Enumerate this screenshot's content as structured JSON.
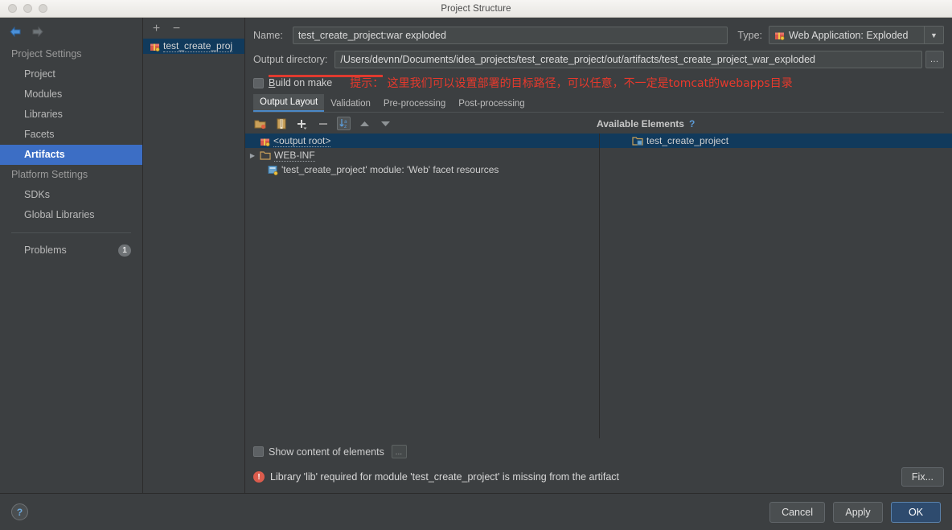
{
  "window": {
    "title": "Project Structure"
  },
  "sidebar": {
    "back_icon": "arrow-left-icon",
    "forward_icon": "arrow-right-icon",
    "groups": [
      {
        "label": "Project Settings",
        "items": [
          {
            "label": "Project",
            "selected": false
          },
          {
            "label": "Modules",
            "selected": false
          },
          {
            "label": "Libraries",
            "selected": false
          },
          {
            "label": "Facets",
            "selected": false
          },
          {
            "label": "Artifacts",
            "selected": true
          }
        ]
      },
      {
        "label": "Platform Settings",
        "items": [
          {
            "label": "SDKs",
            "selected": false
          },
          {
            "label": "Global Libraries",
            "selected": false
          }
        ]
      }
    ],
    "problems": {
      "label": "Problems",
      "count": "1"
    }
  },
  "artifacts_panel": {
    "add_label": "+",
    "remove_label": "−",
    "items": [
      {
        "label": "test_create_proj",
        "icon": "artifact-icon",
        "selected": true
      }
    ]
  },
  "detail": {
    "name_label": "Name:",
    "name_value": "test_create_project:war exploded",
    "type_label": "Type:",
    "type_value": "Web Application: Exploded",
    "type_icon": "artifact-icon",
    "output_label": "Output directory:",
    "output_value": "/Users/devnn/Documents/idea_projects/test_create_project/out/artifacts/test_create_project_war_exploded",
    "browse_label": "…",
    "build_on_make_label": "Build on make",
    "hint_text": "提示： 这里我们可以设置部署的目标路径，可以任意，不一定是tomcat的webapps目录",
    "hint_color": "#e8392c",
    "tabs": [
      {
        "label": "Output Layout",
        "active": true
      },
      {
        "label": "Validation",
        "active": false
      },
      {
        "label": "Pre-processing",
        "active": false
      },
      {
        "label": "Post-processing",
        "active": false
      }
    ],
    "tree_toolbar": [
      {
        "icon": "create-directory-icon"
      },
      {
        "icon": "create-archive-icon"
      },
      {
        "icon": "add-copy-of-icon"
      },
      {
        "icon": "remove-icon"
      },
      {
        "icon": "sort-alphabetically-icon",
        "selected": true
      },
      {
        "icon": "move-up-icon"
      },
      {
        "icon": "move-down-icon"
      }
    ],
    "output_tree": [
      {
        "label": "<output root>",
        "icon": "artifact-icon",
        "indent": 0,
        "selected": true,
        "expander": ""
      },
      {
        "label": "WEB-INF",
        "icon": "folder-icon",
        "indent": 0,
        "selected": false,
        "expander": "▶"
      },
      {
        "label": "'test_create_project' module: 'Web' facet resources",
        "icon": "module-facet-icon",
        "indent": 1,
        "selected": false,
        "expander": ""
      }
    ],
    "available_elements_label": "Available Elements",
    "available_help_icon": "question-mark-icon",
    "available_tree": [
      {
        "label": "test_create_project",
        "icon": "module-icon",
        "selected": true
      }
    ],
    "show_content_label": "Show content of elements",
    "show_content_more": "…",
    "error_text": "Library 'lib' required for module 'test_create_project' is missing from the artifact",
    "error_icon": "error-icon",
    "fix_label": "Fix..."
  },
  "footer": {
    "help_label": "?",
    "cancel_label": "Cancel",
    "apply_label": "Apply",
    "ok_label": "OK"
  }
}
